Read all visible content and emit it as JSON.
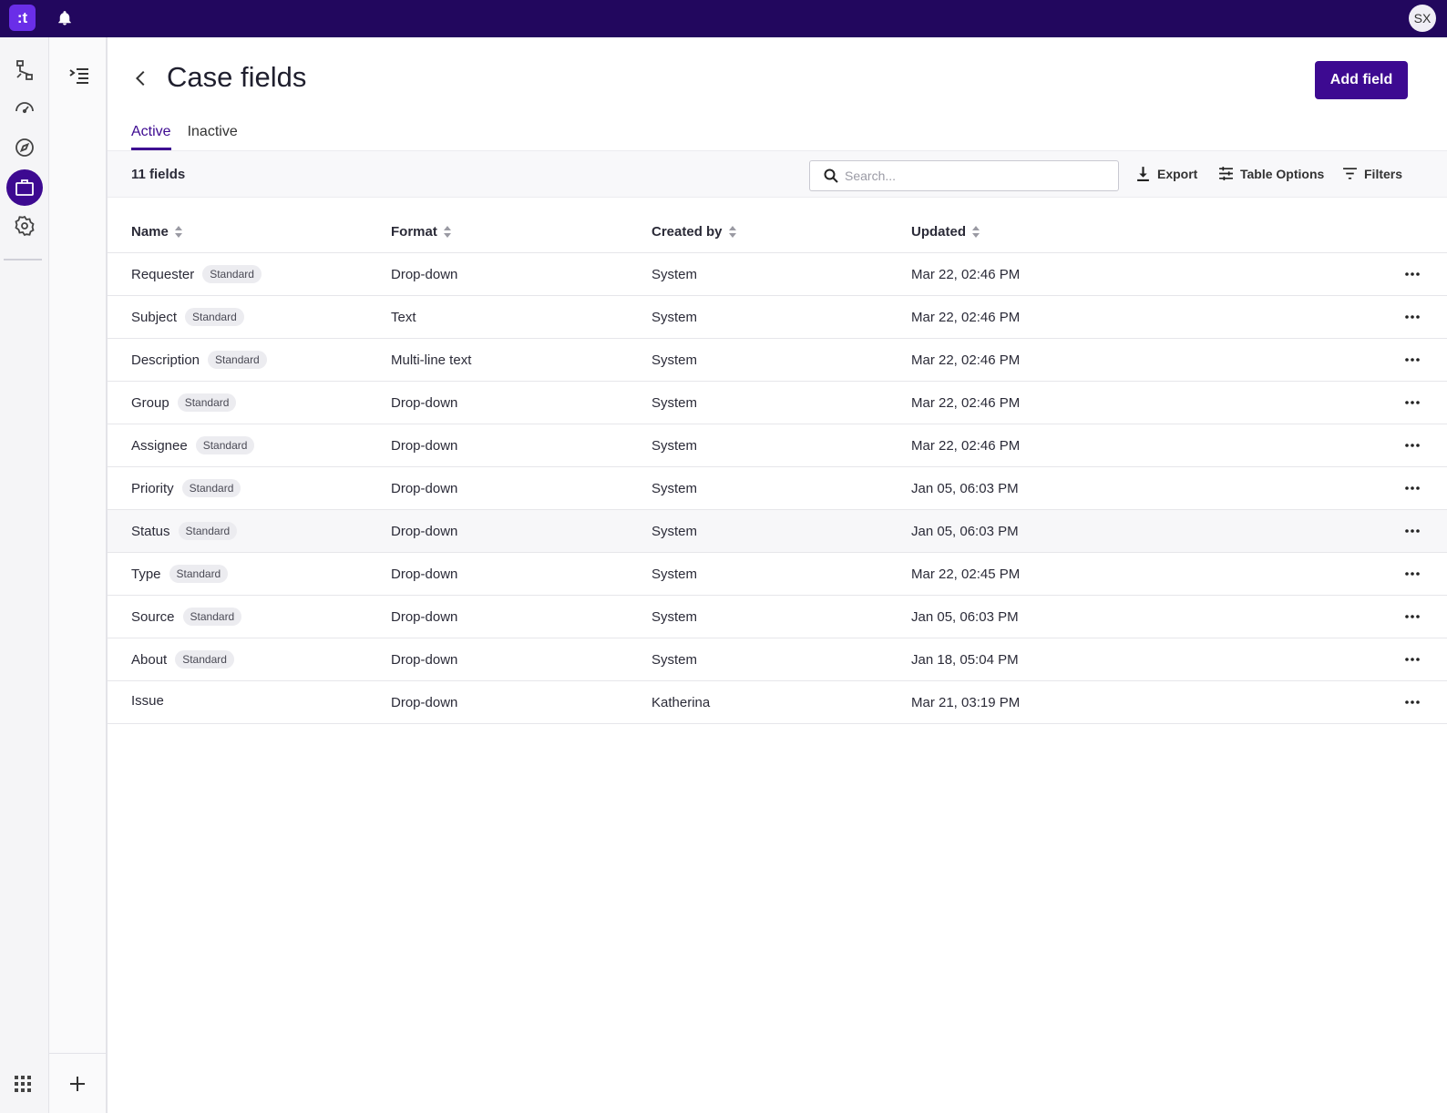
{
  "topbar": {
    "logo_text": ":t",
    "avatar_initials": "SX"
  },
  "page": {
    "title": "Case fields",
    "add_button": "Add field"
  },
  "tabs": [
    {
      "label": "Active"
    },
    {
      "label": "Inactive"
    }
  ],
  "toolbar": {
    "count": "11 fields",
    "search_placeholder": "Search...",
    "export": "Export",
    "table_options": "Table Options",
    "filters": "Filters"
  },
  "table": {
    "columns": [
      "Name",
      "Format",
      "Created by",
      "Updated"
    ],
    "rows": [
      {
        "name": "Requester",
        "badge": "Standard",
        "format": "Drop-down",
        "created_by": "System",
        "updated": "Mar 22, 02:46 PM"
      },
      {
        "name": "Subject",
        "badge": "Standard",
        "format": "Text",
        "created_by": "System",
        "updated": "Mar 22, 02:46 PM"
      },
      {
        "name": "Description",
        "badge": "Standard",
        "format": "Multi-line text",
        "created_by": "System",
        "updated": "Mar 22, 02:46 PM"
      },
      {
        "name": "Group",
        "badge": "Standard",
        "format": "Drop-down",
        "created_by": "System",
        "updated": "Mar 22, 02:46 PM"
      },
      {
        "name": "Assignee",
        "badge": "Standard",
        "format": "Drop-down",
        "created_by": "System",
        "updated": "Mar 22, 02:46 PM"
      },
      {
        "name": "Priority",
        "badge": "Standard",
        "format": "Drop-down",
        "created_by": "System",
        "updated": "Jan 05, 06:03 PM"
      },
      {
        "name": "Status",
        "badge": "Standard",
        "format": "Drop-down",
        "created_by": "System",
        "updated": "Jan 05, 06:03 PM"
      },
      {
        "name": "Type",
        "badge": "Standard",
        "format": "Drop-down",
        "created_by": "System",
        "updated": "Mar 22, 02:45 PM"
      },
      {
        "name": "Source",
        "badge": "Standard",
        "format": "Drop-down",
        "created_by": "System",
        "updated": "Jan 05, 06:03 PM"
      },
      {
        "name": "About",
        "badge": "Standard",
        "format": "Drop-down",
        "created_by": "System",
        "updated": "Jan 18, 05:04 PM"
      },
      {
        "name": "Issue",
        "badge": "",
        "format": "Drop-down",
        "created_by": "Katherina",
        "updated": "Mar 21, 03:19 PM"
      }
    ]
  },
  "colors": {
    "brand_dark": "#22075e",
    "accent": "#3d0a91",
    "logo": "#6a2ee8"
  }
}
